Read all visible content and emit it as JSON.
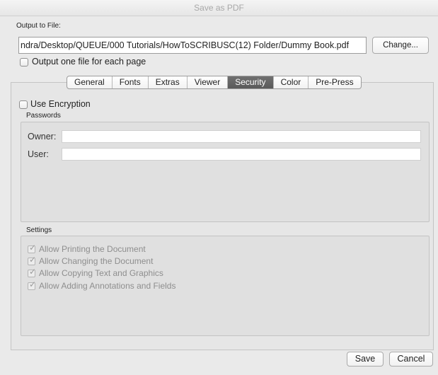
{
  "window": {
    "title": "Save as PDF"
  },
  "output": {
    "label": "Output to File:",
    "path": "ndra/Desktop/QUEUE/000 Tutorials/HowToSCRIBUSC(12) Folder/Dummy Book.pdf",
    "change_label": "Change...",
    "one_file_label": "Output one file for each page"
  },
  "tabs": [
    {
      "label": "General"
    },
    {
      "label": "Fonts"
    },
    {
      "label": "Extras"
    },
    {
      "label": "Viewer"
    },
    {
      "label": "Security"
    },
    {
      "label": "Color"
    },
    {
      "label": "Pre-Press"
    }
  ],
  "active_tab": "Security",
  "security": {
    "use_encryption_label": "Use Encryption",
    "passwords_label": "Passwords",
    "owner_label": "Owner:",
    "user_label": "User:",
    "owner_value": "",
    "user_value": "",
    "settings_label": "Settings",
    "permissions": [
      {
        "label": "Allow Printing the Document",
        "checked": true
      },
      {
        "label": "Allow Changing the Document",
        "checked": true
      },
      {
        "label": "Allow Copying Text and Graphics",
        "checked": true
      },
      {
        "label": "Allow Adding Annotations and Fields",
        "checked": true
      }
    ]
  },
  "footer": {
    "save_label": "Save",
    "cancel_label": "Cancel"
  },
  "icons": {
    "checkmark": "checkmark-icon"
  }
}
